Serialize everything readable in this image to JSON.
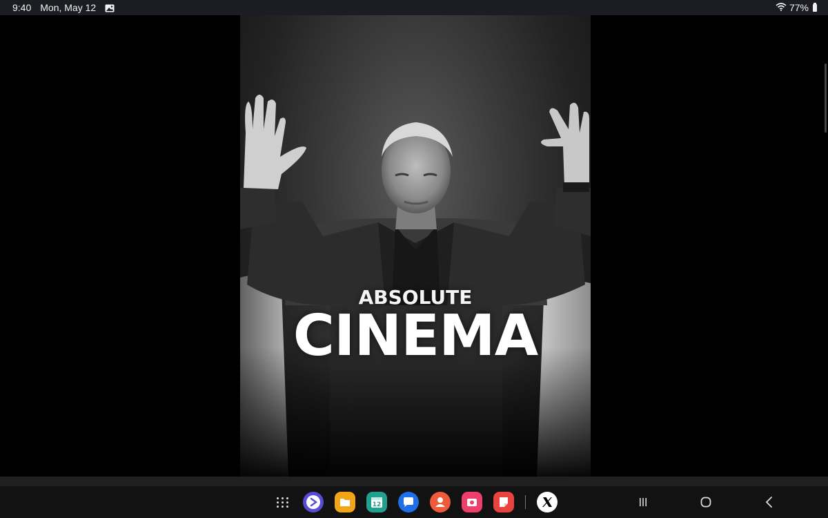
{
  "status_bar": {
    "time": "9:40",
    "date": "Mon, May 12",
    "battery": "77%",
    "icons": [
      "gallery-icon",
      "wifi-icon",
      "battery-icon"
    ]
  },
  "poster": {
    "headline": "ABSOLUTE",
    "title": "CINEMA"
  },
  "dock": {
    "apps": [
      {
        "name": "app-drawer",
        "icon": "grid-dots-icon"
      },
      {
        "name": "samsung-internet",
        "icon": "arrow-right-icon",
        "color": "#5a4bd6"
      },
      {
        "name": "my-files",
        "icon": "folder-icon",
        "color": "#f2a516"
      },
      {
        "name": "calendar",
        "icon": "calendar-icon",
        "color": "#21a08f"
      },
      {
        "name": "messages",
        "icon": "chat-bubble-icon",
        "color": "#1e6fe8"
      },
      {
        "name": "contacts",
        "icon": "person-icon",
        "color": "#ef5a3d"
      },
      {
        "name": "camera",
        "icon": "camera-icon",
        "color": "#ee3e6b"
      },
      {
        "name": "notes",
        "icon": "note-icon",
        "color": "#e8433f"
      },
      {
        "name": "x",
        "icon": "x-logo-icon",
        "color": "#ffffff"
      }
    ],
    "calendar_day": "12"
  },
  "navigation": {
    "recents": "recents-icon",
    "home": "home-icon",
    "back": "back-icon"
  }
}
